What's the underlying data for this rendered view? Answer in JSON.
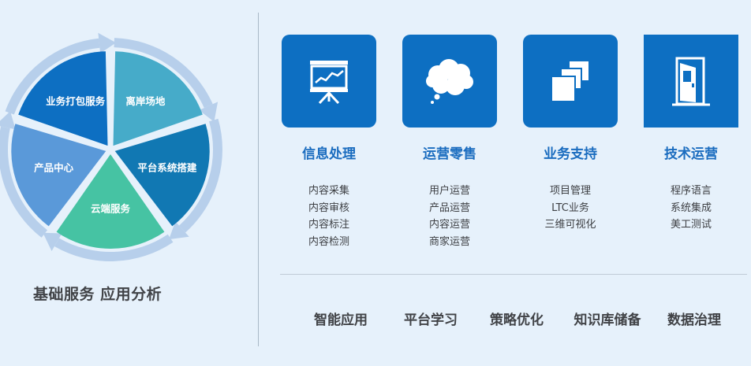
{
  "wheel": {
    "segments": [
      {
        "label": "业务打包服务",
        "color": "#0d6fc2"
      },
      {
        "label": "离岸场地",
        "color": "#46abc9"
      },
      {
        "label": "平台系统搭建",
        "color": "#1178b3"
      },
      {
        "label": "云端服务",
        "color": "#46c3a3"
      },
      {
        "label": "产品中心",
        "color": "#5a99d9"
      }
    ],
    "ring_color": "#b7cfeb"
  },
  "left_caption": "基础服务 应用分析",
  "categories": [
    {
      "icon": "presentation-board-icon",
      "title": "信息处理",
      "items": [
        "内容采集",
        "内容审核",
        "内容标注",
        "内容检测"
      ]
    },
    {
      "icon": "cloud-icon",
      "title": "运营零售",
      "items": [
        "用户运营",
        "产品运营",
        "内容运营",
        "商家运营"
      ]
    },
    {
      "icon": "stacked-squares-icon",
      "title": "业务支持",
      "items": [
        "项目管理",
        "LTC业务",
        "三维可视化"
      ]
    },
    {
      "icon": "door-icon",
      "title": "技术运营",
      "items": [
        "程序语言",
        "系统集成",
        "美工测试"
      ]
    }
  ],
  "bottom_items": [
    "智能应用",
    "平台学习",
    "策略优化",
    "知识库储备",
    "数据治理"
  ],
  "colors": {
    "accent": "#0d6fc2",
    "title": "#1a6cbf",
    "background": "#e6f1fb"
  }
}
